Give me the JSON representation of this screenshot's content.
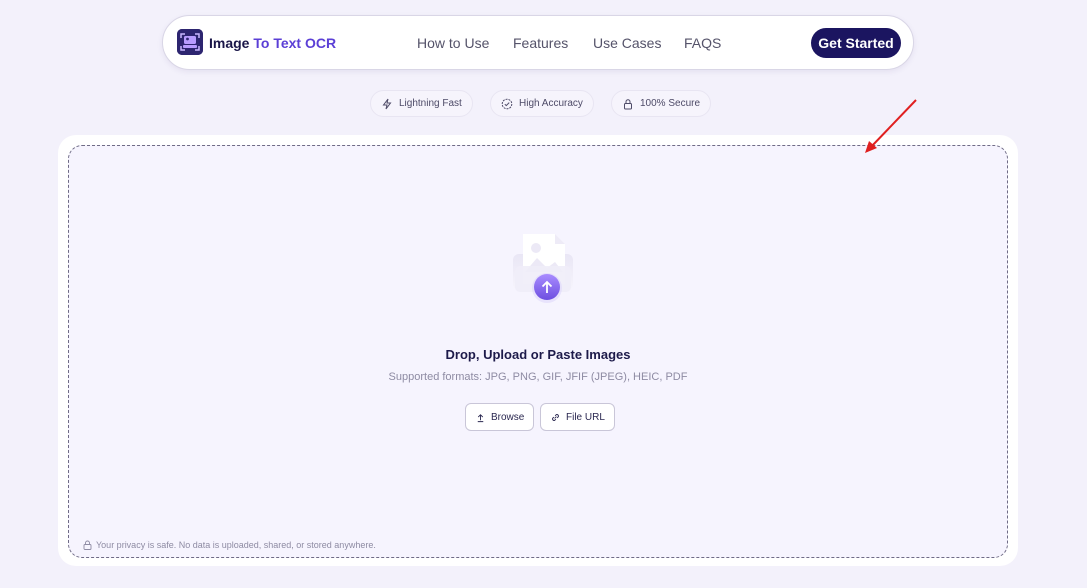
{
  "header": {
    "brand_part1": "Image",
    "brand_part2": "To Text OCR",
    "nav": [
      "How to Use",
      "Features",
      "Use Cases",
      "FAQS"
    ],
    "cta": "Get Started"
  },
  "badges": [
    "Lightning Fast",
    "High Accuracy",
    "100% Secure"
  ],
  "upload": {
    "title": "Drop, Upload or Paste Images",
    "subtitle": "Supported formats: JPG, PNG, GIF, JFIF (JPEG), HEIC, PDF",
    "browse": "Browse",
    "file_url": "File URL",
    "privacy": "Your privacy is safe. No data is uploaded, shared, or stored anywhere."
  },
  "icons": {
    "logo": "image-to-text-logo-icon",
    "badge1": "lightning-icon",
    "badge2": "accuracy-badge-icon",
    "badge3": "lock-icon",
    "upload_art": "image-upload-illustration",
    "browse": "upload-icon",
    "file_url": "link-icon",
    "privacy": "lock-icon"
  },
  "colors": {
    "accent": "#5b3fd6",
    "cta_bg": "#1b1560",
    "background": "#f3f1fb",
    "annotation_arrow": "#e02020"
  }
}
